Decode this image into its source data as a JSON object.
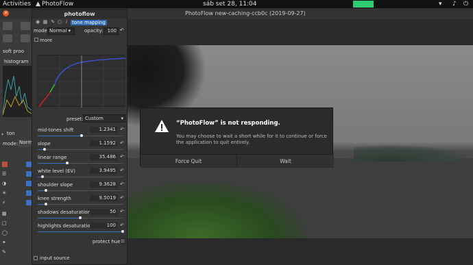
{
  "topbar": {
    "activities": "Activities",
    "app": "PhotoFlow",
    "clock": "sáb set 28, 11:04"
  },
  "window": {
    "title": "PhotoFlow new-caching-ccb0c (2019-09-27)"
  },
  "left": {
    "soft_proof": "soft proo",
    "histogram": "histogram",
    "tone_short": "ton",
    "mode_short": "Norm"
  },
  "panel": {
    "title": "photoflow",
    "layer_name": "tone mapping",
    "mode_label": "mode:",
    "mode_value": "Normal",
    "opacity_label": "opacity:",
    "opacity_value": "100",
    "more": "more",
    "preset_label": "preset:",
    "preset_value": "Custom",
    "sliders": [
      {
        "label": "mid-tones shift",
        "value": "1.2341",
        "pos": 0.52
      },
      {
        "label": "slope",
        "value": "1.1592",
        "pos": 0.08
      },
      {
        "label": "linear range",
        "value": "35.486",
        "pos": 0.35
      },
      {
        "label": "white level (EV)",
        "value": "3.9495",
        "pos": 0.06
      },
      {
        "label": "shoulder slope",
        "value": "9.3628",
        "pos": 0.1
      },
      {
        "label": "knee strength",
        "value": "9.5019",
        "pos": 0.1
      },
      {
        "label": "shadows desaturation",
        "value": "50",
        "pos": 0.5
      },
      {
        "label": "highlights desaturation",
        "value": "100",
        "pos": 1.0
      }
    ],
    "protect_hues": "protect hues",
    "input_source": "input source"
  },
  "dialog": {
    "heading": "“PhotoFlow” is not responding.",
    "message": "You may choose to wait a short while for it to continue or force the application to quit entirely.",
    "force_quit": "Force Quit",
    "wait": "Wait"
  },
  "colors": {
    "accent": "#2f6ab5",
    "close": "#e95420"
  }
}
